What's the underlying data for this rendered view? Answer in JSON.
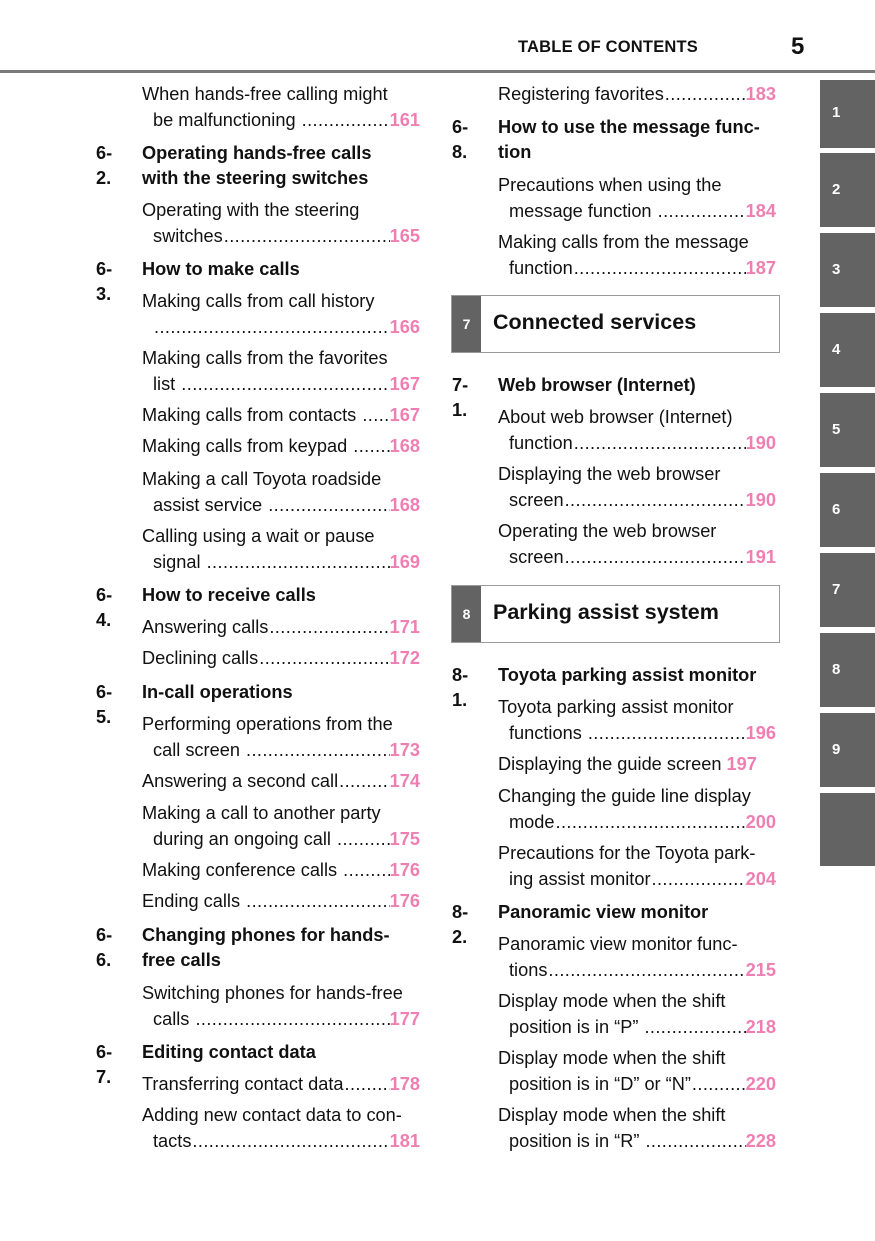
{
  "header": {
    "title": "TABLE OF CONTENTS",
    "page_number": "5"
  },
  "colors": {
    "page_number_pink": "#ef7fb2",
    "tab_gray": "#636363",
    "rule_gray": "#7a7a7a"
  },
  "left_column": {
    "top_item": {
      "line1": "When hands-free calling might",
      "line2": "be malfunctioning",
      "page": "161"
    },
    "sections": [
      {
        "num": "6-2.",
        "title_line1": "Operating hands-free calls",
        "title_line2": "with the steering switches",
        "items": [
          {
            "line1": "Operating with the steering",
            "line2": "switches",
            "page": "165"
          }
        ]
      },
      {
        "num": "6-3.",
        "title": "How to make calls",
        "items": [
          {
            "line1": "Making calls from call history",
            "line2": "",
            "page": "166"
          },
          {
            "line1": "Making calls from the favorites",
            "line2": "list",
            "page": "167"
          },
          {
            "text": "Making calls from contacts",
            "page": "167"
          },
          {
            "text": "Making calls from keypad",
            "page": "168"
          },
          {
            "line1": "Making a call Toyota roadside",
            "line2": "assist service",
            "page": "168"
          },
          {
            "line1": "Calling using a wait or pause",
            "line2": "signal",
            "page": "169"
          }
        ]
      },
      {
        "num": "6-4.",
        "title": "How to receive calls",
        "items": [
          {
            "text": "Answering calls",
            "page": "171"
          },
          {
            "text": "Declining calls",
            "page": "172"
          }
        ]
      },
      {
        "num": "6-5.",
        "title": "In-call operations",
        "items": [
          {
            "line1": "Performing operations from the",
            "line2": "call screen",
            "page": "173"
          },
          {
            "text": "Answering a second call",
            "page": "174"
          },
          {
            "line1": "Making a call to another party",
            "line2": "during an ongoing call",
            "page": "175"
          },
          {
            "text": "Making conference calls",
            "page": "176"
          },
          {
            "text": "Ending calls",
            "page": "176"
          }
        ]
      },
      {
        "num": "6-6.",
        "title_line1": "Changing phones for hands-",
        "title_line2": "free calls",
        "items": [
          {
            "line1": "Switching phones for hands-free",
            "line2": "calls",
            "page": "177"
          }
        ]
      },
      {
        "num": "6-7.",
        "title": "Editing contact data",
        "items": [
          {
            "text": "Transferring contact data",
            "page": "178"
          },
          {
            "line1": "Adding new contact data to con-",
            "line2": "tacts",
            "page": "181"
          }
        ]
      }
    ]
  },
  "right_column": {
    "top_item": {
      "text": "Registering favorites",
      "page": "183"
    },
    "section_6_8": {
      "num": "6-8.",
      "title_line1": "How to use the message func-",
      "title_line2": "tion",
      "items": [
        {
          "line1": "Precautions when using the",
          "line2": "message function",
          "page": "184"
        },
        {
          "line1": "Making calls from the message",
          "line2": "function",
          "page": "187"
        }
      ]
    },
    "chapter_7": {
      "num": "7",
      "title": "Connected services"
    },
    "section_7_1": {
      "num": "7-1.",
      "title": "Web browser (Internet)",
      "items": [
        {
          "line1": "About web browser (Internet)",
          "line2": "function",
          "page": "190"
        },
        {
          "line1": "Displaying the web browser",
          "line2": "screen",
          "page": "190"
        },
        {
          "line1": "Operating the web browser",
          "line2": "screen",
          "page": "191"
        }
      ]
    },
    "chapter_8": {
      "num": "8",
      "title": "Parking assist system"
    },
    "section_8_1": {
      "num": "8-1.",
      "title": "Toyota parking assist monitor",
      "items": [
        {
          "line1": "Toyota parking assist monitor",
          "line2": "functions",
          "page": "196"
        },
        {
          "text": "Displaying the guide screen",
          "page": "197"
        },
        {
          "line1": "Changing the guide line display",
          "line2": "mode",
          "page": "200"
        },
        {
          "line1": "Precautions for the Toyota park-",
          "line2": "ing assist monitor",
          "page": "204"
        }
      ]
    },
    "section_8_2": {
      "num": "8-2.",
      "title": "Panoramic view monitor",
      "items": [
        {
          "line1": "Panoramic view monitor func-",
          "line2": "tions",
          "page": "215"
        },
        {
          "line1": "Display mode when the shift",
          "line2": "position is in “P”",
          "page": "218"
        },
        {
          "line1": "Display mode when the shift",
          "line2": "position is in “D” or “N”",
          "page": "220"
        },
        {
          "line1": "Display mode when the shift",
          "line2": "position is in “R”",
          "page": "228"
        }
      ]
    }
  },
  "side_tabs": [
    "1",
    "2",
    "3",
    "4",
    "5",
    "6",
    "7",
    "8",
    "9",
    ""
  ]
}
